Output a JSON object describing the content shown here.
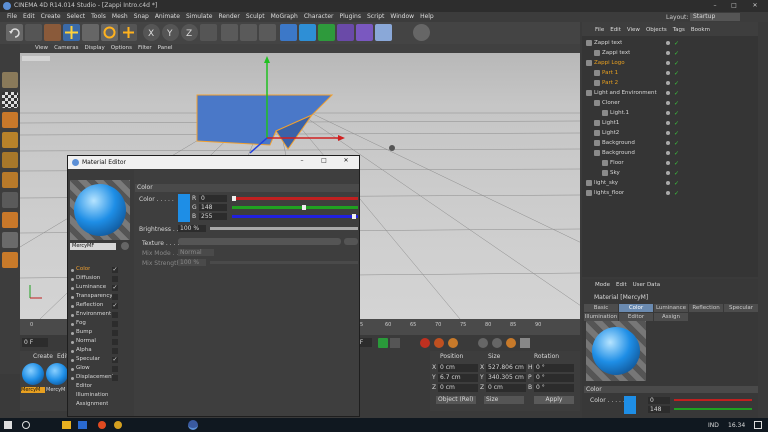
{
  "window": {
    "title": "CINEMA 4D R14.014 Studio - [Zappi Intro.c4d *]",
    "layout_label": "Layout:",
    "layout_value": "Startup"
  },
  "menu": [
    "File",
    "Edit",
    "Create",
    "Select",
    "Tools",
    "Mesh",
    "Snap",
    "Animate",
    "Simulate",
    "Render",
    "Sculpt",
    "MoGraph",
    "Character",
    "Plugins",
    "Script",
    "Window",
    "Help"
  ],
  "viewport_menu": [
    "View",
    "Cameras",
    "Display",
    "Options",
    "Filter",
    "Panel"
  ],
  "timeline": {
    "ticks": [
      "0",
      "5",
      "60",
      "65",
      "70",
      "75",
      "80",
      "85",
      "90"
    ],
    "frame_start": "0 F",
    "frame_end": "0 F"
  },
  "coords": {
    "headers": [
      "Position",
      "Size",
      "Rotation"
    ],
    "rows": [
      {
        "p_axis": "X",
        "p": "0 cm",
        "s_axis": "X",
        "s": "527.806 cm",
        "r_axis": "H",
        "r": "0 °"
      },
      {
        "p_axis": "Y",
        "p": "6.7 cm",
        "s_axis": "Y",
        "s": "340.305 cm",
        "r_axis": "P",
        "r": "0 °"
      },
      {
        "p_axis": "Z",
        "p": "0 cm",
        "s_axis": "Z",
        "s": "0 cm",
        "r_axis": "B",
        "r": "0 °"
      }
    ],
    "mode": "Object (Rel)",
    "size_mode": "Size",
    "apply": "Apply"
  },
  "material_manager": {
    "menu": [
      "Create",
      "Edit"
    ],
    "items": [
      "MercyM",
      "MercyM"
    ]
  },
  "objmgr": {
    "menu": [
      "File",
      "Edit",
      "View",
      "Objects",
      "Tags",
      "Bookm"
    ],
    "objects": [
      {
        "name": "Zappi text",
        "indent": 0,
        "color": "#d8d8d8"
      },
      {
        "name": "Zappi text",
        "indent": 1,
        "color": "#d8d8d8"
      },
      {
        "name": "Zappi Logo",
        "indent": 0,
        "color": "#e8a020"
      },
      {
        "name": "Part 1",
        "indent": 1,
        "color": "#e8a020"
      },
      {
        "name": "Part 2",
        "indent": 1,
        "color": "#e8a020"
      },
      {
        "name": "Light and Environment",
        "indent": 0,
        "color": "#d8d8d8"
      },
      {
        "name": "Cloner",
        "indent": 1,
        "color": "#d8d8d8"
      },
      {
        "name": "Light.1",
        "indent": 2,
        "color": "#d8d8d8"
      },
      {
        "name": "Light1",
        "indent": 1,
        "color": "#d8d8d8"
      },
      {
        "name": "Light2",
        "indent": 1,
        "color": "#d8d8d8"
      },
      {
        "name": "Background",
        "indent": 1,
        "color": "#d8d8d8"
      },
      {
        "name": "Background",
        "indent": 1,
        "color": "#d8d8d8"
      },
      {
        "name": "Floor",
        "indent": 2,
        "color": "#d8d8d8"
      },
      {
        "name": "Sky",
        "indent": 2,
        "color": "#d8d8d8"
      },
      {
        "name": "light_sky",
        "indent": 0,
        "color": "#d8d8d8"
      },
      {
        "name": "lights_floor",
        "indent": 0,
        "color": "#d8d8d8"
      }
    ]
  },
  "attr": {
    "menu": [
      "Mode",
      "Edit",
      "User Data"
    ],
    "title": "Material [MercyM]",
    "tabs_row1": [
      "Basic",
      "Color",
      "Luminance",
      "Reflection",
      "Specular"
    ],
    "tabs_row2": [
      "Illumination",
      "Editor",
      "Assign"
    ],
    "section": "Color",
    "color_label": "Color . . . . .",
    "r": "0",
    "g": "148"
  },
  "editor": {
    "title": "Material Editor",
    "mat_name": "MercyMF",
    "channels": [
      {
        "name": "Color",
        "checked": true,
        "active": true
      },
      {
        "name": "Diffusion",
        "checked": false
      },
      {
        "name": "Luminance",
        "checked": true
      },
      {
        "name": "Transparency",
        "checked": false
      },
      {
        "name": "Reflection",
        "checked": true
      },
      {
        "name": "Environment",
        "checked": false
      },
      {
        "name": "Fog",
        "checked": false
      },
      {
        "name": "Bump",
        "checked": false
      },
      {
        "name": "Normal",
        "checked": false
      },
      {
        "name": "Alpha",
        "checked": false
      },
      {
        "name": "Specular",
        "checked": true
      },
      {
        "name": "Glow",
        "checked": false
      },
      {
        "name": "Displacement",
        "checked": false
      },
      {
        "name": "Editor",
        "checked": null
      },
      {
        "name": "Illumination",
        "checked": null
      },
      {
        "name": "Assignment",
        "checked": null
      }
    ],
    "section": "Color",
    "color_label": "Color . . . . .",
    "r_label": "R",
    "r": "0",
    "g_label": "G",
    "g": "148",
    "b_label": "B",
    "b": "255",
    "r_fraction": 0,
    "g_fraction": 0.58,
    "b_fraction": 1,
    "brightness_label": "Brightness . .",
    "brightness": "100 %",
    "brightness_fraction": 1,
    "texture_label": "Texture . . . .",
    "mix_mode_label": "Mix Mode . . .",
    "mix_mode": "Normal",
    "mix_strength_label": "Mix Strength .",
    "mix_strength": "100 %"
  },
  "taskbar": {
    "lang": "IND",
    "time": "16.34"
  },
  "colors": {
    "blue": "#1e8ee6",
    "orange": "#e8a020",
    "panel": "#3b3b3b"
  }
}
